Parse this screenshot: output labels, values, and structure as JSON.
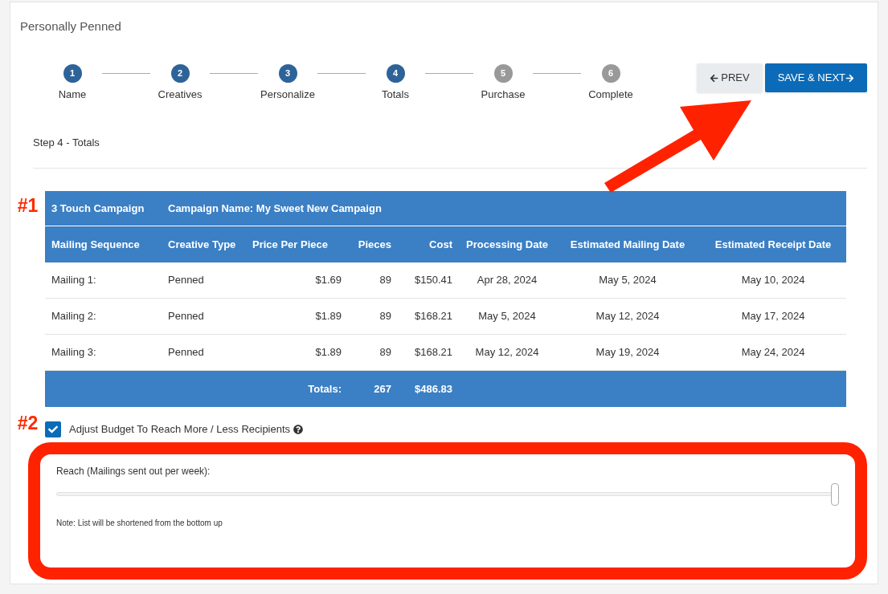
{
  "page": {
    "title": "Personally Penned"
  },
  "steps": [
    {
      "number": "1",
      "label": "Name",
      "reached": true
    },
    {
      "number": "2",
      "label": "Creatives",
      "reached": true
    },
    {
      "number": "3",
      "label": "Personalize",
      "reached": true
    },
    {
      "number": "4",
      "label": "Totals",
      "reached": true
    },
    {
      "number": "5",
      "label": "Purchase",
      "reached": false
    },
    {
      "number": "6",
      "label": "Complete",
      "reached": false
    }
  ],
  "buttons": {
    "prev": "PREV",
    "next": "SAVE & NEXT"
  },
  "step_heading": "Step 4 - Totals",
  "table": {
    "marker": "#1",
    "campaign_type": "3 Touch Campaign",
    "campaign_name": "Campaign Name: My Sweet New Campaign",
    "columns": [
      "Mailing Sequence",
      "Creative Type",
      "Price Per Piece",
      "Pieces",
      "Cost",
      "Processing Date",
      "Estimated Mailing Date",
      "Estimated Receipt Date"
    ],
    "rows": [
      [
        "Mailing 1:",
        "Penned",
        "$1.69",
        "89",
        "$150.41",
        "Apr 28, 2024",
        "May 5, 2024",
        "May 10, 2024"
      ],
      [
        "Mailing 2:",
        "Penned",
        "$1.89",
        "89",
        "$168.21",
        "May 5, 2024",
        "May 12, 2024",
        "May 17, 2024"
      ],
      [
        "Mailing 3:",
        "Penned",
        "$1.89",
        "89",
        "$168.21",
        "May 12, 2024",
        "May 19, 2024",
        "May 24, 2024"
      ]
    ],
    "totals": {
      "label": "Totals:",
      "pieces": "267",
      "cost": "$486.83"
    }
  },
  "budget": {
    "marker": "#2",
    "label": "Adjust Budget To Reach More / Less Recipients",
    "checked": true,
    "reach": {
      "label": "Reach (Mailings sent out per week):",
      "level": 1,
      "note": "Note: List will be shortened from the bottom up"
    }
  }
}
